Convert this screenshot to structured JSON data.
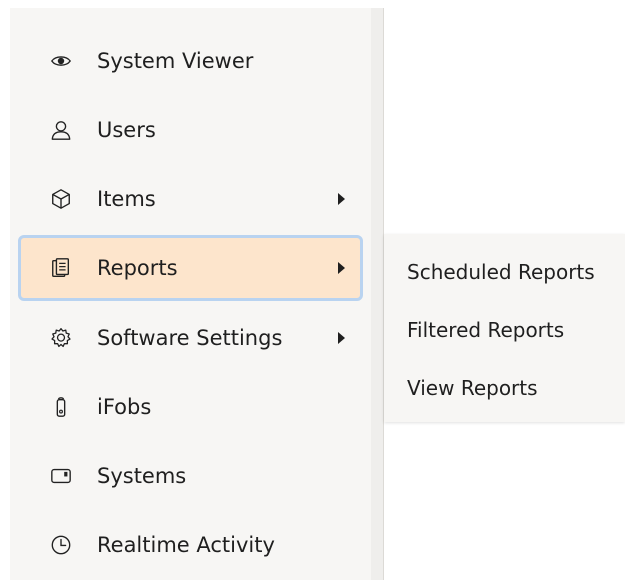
{
  "sidebar": {
    "items": [
      {
        "label": "System Viewer",
        "icon": "eye-icon"
      },
      {
        "label": "Users",
        "icon": "user-icon"
      },
      {
        "label": "Items",
        "icon": "cube-icon"
      },
      {
        "label": "Reports",
        "icon": "reports-icon"
      },
      {
        "label": "Software Settings",
        "icon": "gear-icon"
      },
      {
        "label": "iFobs",
        "icon": "fob-icon"
      },
      {
        "label": "Systems",
        "icon": "device-icon"
      },
      {
        "label": "Realtime Activity",
        "icon": "clock-icon"
      }
    ]
  },
  "submenu": {
    "items": [
      {
        "label": "Scheduled Reports"
      },
      {
        "label": "Filtered Reports"
      },
      {
        "label": "View Reports"
      }
    ]
  },
  "colors": {
    "active_bg": "#fde5cc",
    "active_border": "#b9d3f0",
    "sidebar_bg": "#f7f6f4"
  }
}
